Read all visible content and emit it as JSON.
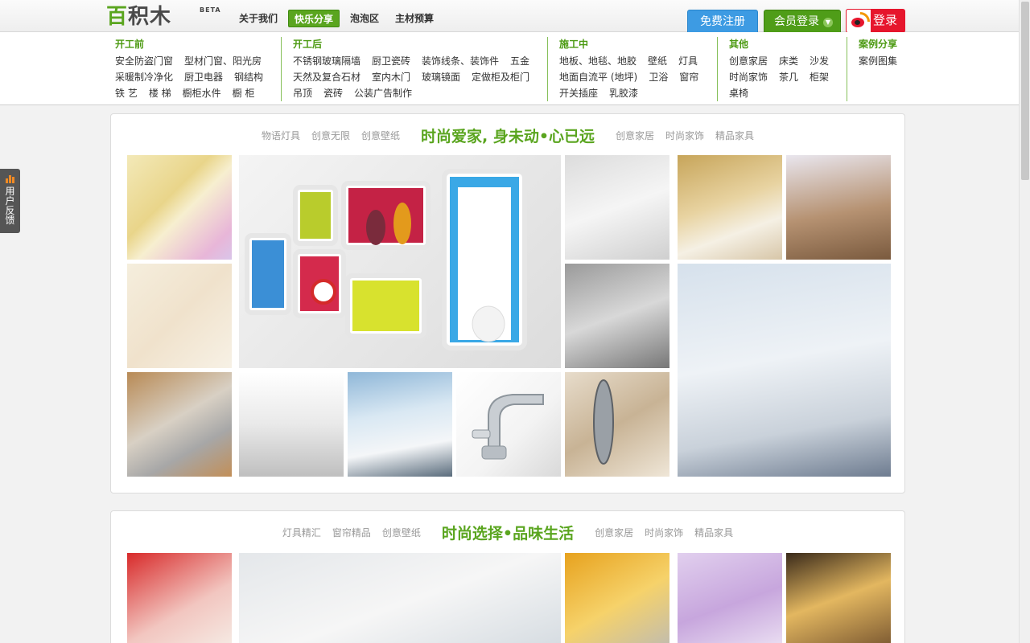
{
  "logo": {
    "text_a": "百",
    "text_b": "积木",
    "beta": "BETA"
  },
  "topnav": [
    {
      "label": "关于我们",
      "active": false
    },
    {
      "label": "快乐分享",
      "active": true
    },
    {
      "label": "泡泡区",
      "active": false
    },
    {
      "label": "主材预算",
      "active": false
    }
  ],
  "auth": {
    "register": "免费注册",
    "login": "会员登录",
    "weibo": "登录"
  },
  "categories": [
    {
      "head": "开工前",
      "rows": [
        [
          "安全防盗门窗",
          "型材门窗、阳光房"
        ],
        [
          "采暖制冷净化",
          "厨卫电器",
          "钢结构"
        ],
        [
          "铁 艺",
          "楼 梯",
          "橱柜水件",
          "橱 柜"
        ]
      ]
    },
    {
      "head": "开工后",
      "rows": [
        [
          "不锈钢玻璃隔墙",
          "厨卫瓷砖",
          "装饰线条、装饰件",
          "五金"
        ],
        [
          "天然及复合石材",
          "室内木门",
          "玻璃镜面",
          "定做柜及柜门"
        ],
        [
          "吊顶",
          "瓷砖",
          "公装广告制作"
        ]
      ]
    },
    {
      "head": "施工中",
      "rows": [
        [
          "地板、地毯、地胶",
          "壁纸",
          "灯具"
        ],
        [
          "地面自流平 (地坪)",
          "卫浴",
          "窗帘"
        ],
        [
          "开关插座",
          "乳胶漆"
        ]
      ]
    },
    {
      "head": "其他",
      "rows": [
        [
          "创意家居",
          "床类",
          "沙发"
        ],
        [
          "时尚家饰",
          "茶几",
          "柜架"
        ],
        [
          "桌椅"
        ]
      ]
    },
    {
      "head": "案例分享",
      "rows": [
        [
          "案例图集"
        ]
      ]
    }
  ],
  "feedback": {
    "label": "用户反馈"
  },
  "section1": {
    "left_tabs": [
      "物语灯具",
      "创意无限",
      "创意壁纸"
    ],
    "headline": "时尚爱家, 身未动•心已远",
    "right_tabs": [
      "创意家居",
      "时尚家饰",
      "精品家具"
    ]
  },
  "section2": {
    "left_tabs": [
      "灯具精汇",
      "窗帘精品",
      "创意壁纸"
    ],
    "headline": "时尚选择•品味生活",
    "right_tabs": [
      "创意家居",
      "时尚家饰",
      "精品家具"
    ]
  },
  "photos1": [
    {
      "name": "curtains-photo",
      "bg": "linear-gradient(135deg,#f3e9b8,#e9d58a 40%,#f7efd0 55%,#e8b6d8 85%,#d9c5e9)"
    },
    {
      "name": "wall-shelves-photo",
      "bg": "linear-gradient(135deg,#f4f4f4,#e8e8e8 50%,#dcdcdc)"
    },
    {
      "name": "bathroom-cabinet-photo",
      "bg": "linear-gradient(160deg,#dcdcdc,#f5f5f5 50%,#cfcfcf)"
    },
    {
      "name": "bedroom-lamp-photo",
      "bg": "linear-gradient(160deg,#c7a55a,#e8d3a1 45%,#f5f0e4 70%,#d7c6a8)"
    },
    {
      "name": "ceiling-light-photo",
      "bg": "linear-gradient(170deg,#e9e6ee,#b69272 55%,#7a5a3e)"
    },
    {
      "name": "floral-wallpaper-photo",
      "bg": "linear-gradient(135deg,#f5eedd,#f0e2cc 50%,#f7f1e5)"
    },
    {
      "name": "shower-set-photo",
      "bg": "linear-gradient(160deg,#9a9a9a,#d8d8d8 50%,#777)"
    },
    {
      "name": "tv-cabinet-photo",
      "bg": "linear-gradient(170deg,#d6e1ec,#eef2f6 45%,#c9d1da 75%,#6e7c90)"
    },
    {
      "name": "kitchen-basket-photo",
      "bg": "linear-gradient(150deg,#b88a55,#d8d0c4 45%,#a7a7a7 70%,#c28f58)"
    },
    {
      "name": "range-hood-photo",
      "bg": "linear-gradient(180deg,#ffffff,#e9e9e9 50%,#bfbfbf)"
    },
    {
      "name": "bathtub-photo",
      "bg": "linear-gradient(170deg,#8fb7d8,#d9e8f3 40%,#f4f6f8 70%,#5a6c7c)"
    },
    {
      "name": "faucet-photo",
      "bg": "linear-gradient(135deg,#ffffff,#f3f3f3 60%,#d9d9d9)"
    },
    {
      "name": "oval-mirror-photo",
      "bg": "linear-gradient(150deg,#e7dccb,#c8b395 50%,#efe6d7)"
    }
  ],
  "photos2": [
    {
      "name": "bead-curtain-photo",
      "bg": "linear-gradient(150deg,#d82a2a,#f2c6c0 55%,#f6f1ea)"
    },
    {
      "name": "bedroom-wallpaper-photo",
      "bg": "linear-gradient(160deg,#e4e7ea,#f6f6f6 50%,#d2d9df)"
    },
    {
      "name": "towel-rack-photo",
      "bg": "linear-gradient(150deg,#e7a21e,#f6d26a 50%,#b9b9b9)"
    },
    {
      "name": "purple-ceiling-lamp-photo",
      "bg": "linear-gradient(160deg,#e1cfee,#c7a6dd 50%,#f1e9f6)"
    },
    {
      "name": "wall-sconce-photo",
      "bg": "linear-gradient(160deg,#3a2a1a,#e3b760 45%,#6b4a2a)"
    }
  ]
}
